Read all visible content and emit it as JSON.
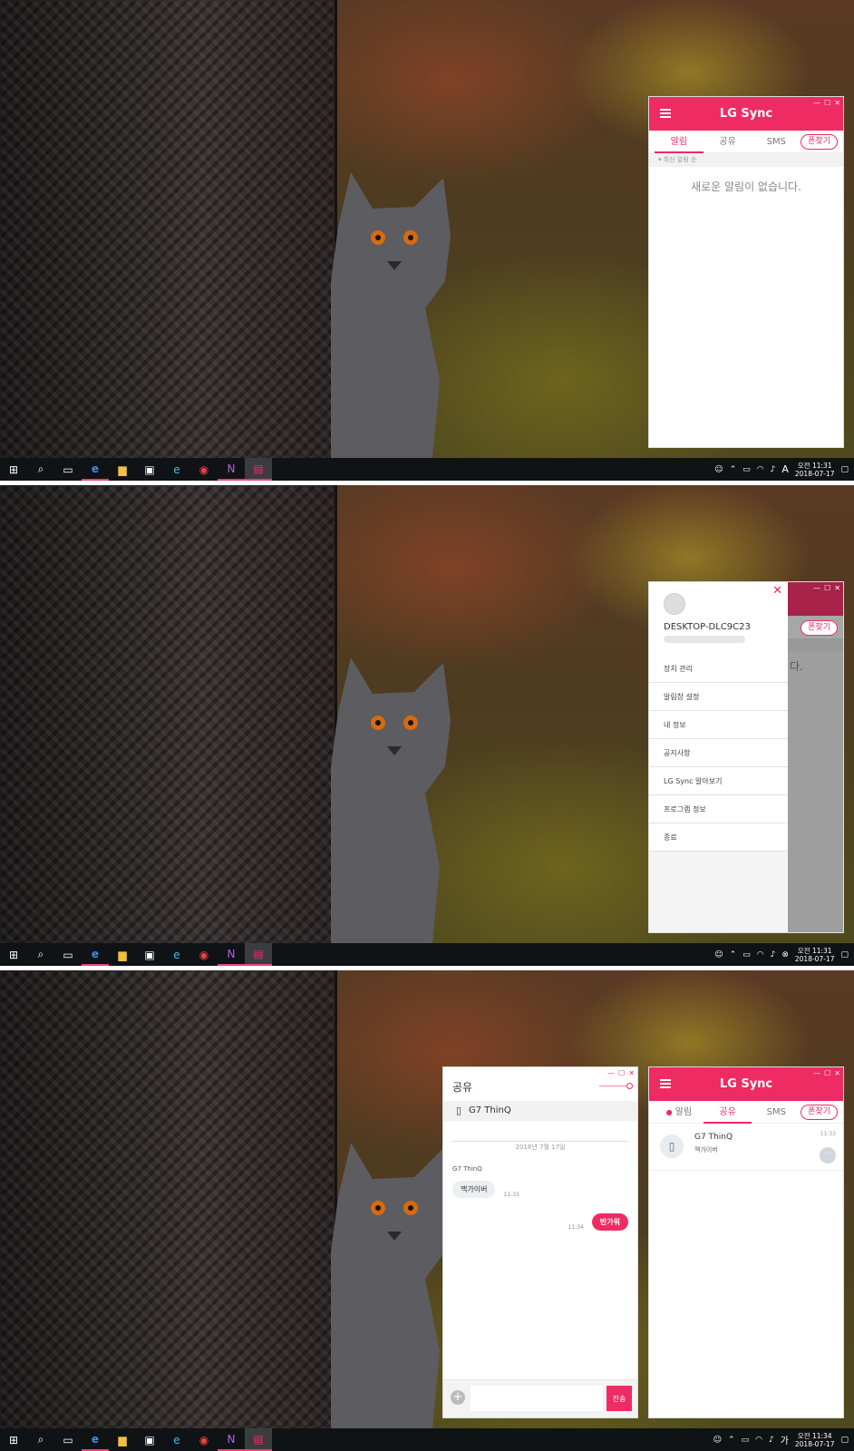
{
  "app": {
    "title": "LG Sync"
  },
  "tabs": {
    "alerts": "알림",
    "share": "공유",
    "sms": "SMS",
    "find_phone": "폰찾기"
  },
  "alerts": {
    "sort_label": "최신 알림 순",
    "empty_message": "새로운 알림이 없습니다."
  },
  "drawer": {
    "device_name": "DESKTOP-DLC9C23",
    "items": [
      {
        "label": "장치 관리"
      },
      {
        "label": "알림창 설정"
      },
      {
        "label": "내 정보"
      },
      {
        "label": "공지사항"
      },
      {
        "label": "LG Sync 알아보기"
      },
      {
        "label": "프로그램 정보"
      },
      {
        "label": "종료"
      }
    ],
    "dimmed_text": "다."
  },
  "share_list": {
    "device": "G7 ThinQ",
    "last_message": "맥가이버",
    "time": "11:33"
  },
  "chat": {
    "title": "공유",
    "device": "G7 ThinQ",
    "date_divider": "2018년 7월 17일",
    "sender": "G7 ThinQ",
    "messages": [
      {
        "text": "맥가이버",
        "time": "11:33",
        "dir": "in"
      },
      {
        "text": "반가워",
        "time": "11:34",
        "dir": "out"
      }
    ],
    "input_placeholder": "",
    "send_label": "전송"
  },
  "taskbar": {
    "panel1": {
      "time": "오전 11:31",
      "date": "2018-07-17",
      "ime": "A"
    },
    "panel2": {
      "time": "오전 11:31",
      "date": "2018-07-17"
    },
    "panel3": {
      "time": "오전 11:34",
      "date": "2018-07-17",
      "ime": "가"
    }
  },
  "colors": {
    "accent": "#ee2b63",
    "taskbar": "#101316"
  }
}
